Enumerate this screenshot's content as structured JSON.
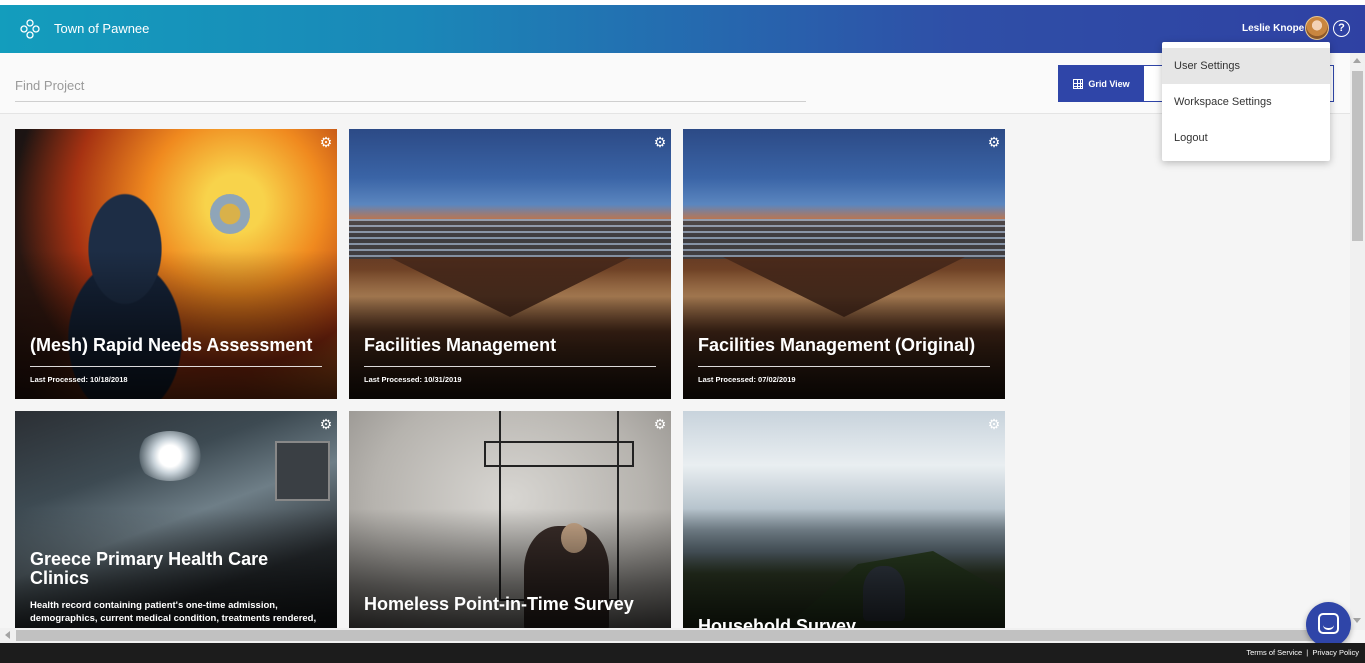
{
  "header": {
    "app_title": "Town of Pawnee",
    "user_name": "Leslie Knope",
    "help_glyph": "?"
  },
  "toolbar": {
    "search_placeholder": "Find Project",
    "grid_view_label": "Grid View"
  },
  "user_menu": {
    "items": [
      "User Settings",
      "Workspace Settings",
      "Logout"
    ]
  },
  "projects": [
    {
      "title": "(Mesh) Rapid Needs Assessment",
      "last_processed": "Last Processed: 10/18/2018"
    },
    {
      "title": "Facilities Management",
      "last_processed": "Last Processed: 10/31/2019"
    },
    {
      "title": "Facilities Management (Original)",
      "last_processed": "Last Processed: 07/02/2019"
    },
    {
      "title": "Greece Primary Health Care Clinics",
      "description": "Health record containing patient's one-time admission, demographics, current medical condition, treatments rendered,"
    },
    {
      "title": "Homeless Point-in-Time Survey"
    },
    {
      "title": "Household Survey"
    }
  ],
  "footer": {
    "terms": "Terms of Service",
    "separator": "|",
    "privacy": "Privacy Policy"
  },
  "colors": {
    "header_gradient_start": "#139dbd",
    "header_gradient_end": "#2f41a3",
    "primary": "#2f45a8",
    "footer_bg": "#1c1c1c"
  }
}
